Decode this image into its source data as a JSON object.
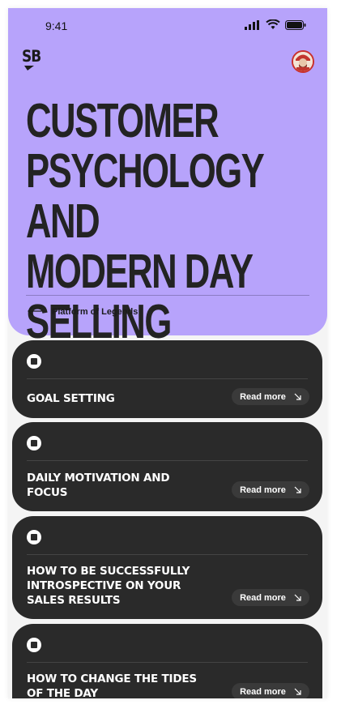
{
  "status": {
    "time": "9:41"
  },
  "app": {
    "logo_text": "SB"
  },
  "hero": {
    "title_lines": [
      "CUSTOMER",
      "PSYCHOLOGY AND",
      "MODERN DAY",
      "SELLING"
    ],
    "subtitle": "Platform of Legends"
  },
  "cards": [
    {
      "title": "GOAL SETTING",
      "read_more": "Read more"
    },
    {
      "title": "DAILY MOTIVATION AND FOCUS",
      "read_more": "Read more"
    },
    {
      "title": "HOW TO BE SUCCESSFULLY INTROSPECTIVE ON YOUR SALES RESULTS",
      "read_more": "Read more"
    },
    {
      "title": "HOW TO CHANGE THE TIDES OF THE DAY",
      "read_more": "Read more"
    }
  ],
  "icons": {
    "back": "arrow-left-icon",
    "bullet": "stop-square-icon",
    "read_more": "arrow-down-right-icon",
    "signal": "signal-icon",
    "wifi": "wifi-icon",
    "battery": "battery-icon"
  },
  "colors": {
    "hero_bg": "#b7a3fb",
    "card_bg": "#2a2a2a",
    "page_bg": "#f4f4f4"
  }
}
